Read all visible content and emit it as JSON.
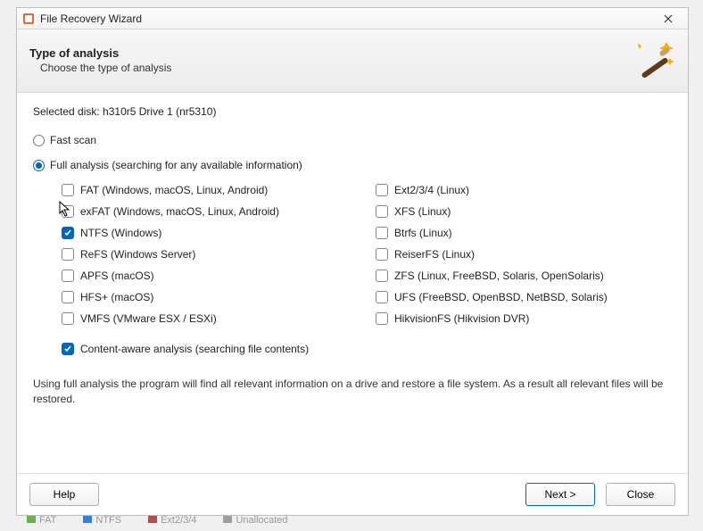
{
  "window": {
    "title": "File Recovery Wizard"
  },
  "header": {
    "title": "Type of analysis",
    "subtitle": "Choose the type of analysis"
  },
  "selected_disk_label": "Selected disk: h310r5 Drive 1 (nr5310)",
  "radios": {
    "fast_label": "Fast scan",
    "full_label": "Full analysis (searching for any available information)"
  },
  "filesystems_left": [
    {
      "label": "FAT (Windows, macOS, Linux, Android)",
      "checked": false
    },
    {
      "label": "exFAT (Windows, macOS, Linux, Android)",
      "checked": false
    },
    {
      "label": "NTFS (Windows)",
      "checked": true
    },
    {
      "label": "ReFS (Windows Server)",
      "checked": false
    },
    {
      "label": "APFS (macOS)",
      "checked": false
    },
    {
      "label": "HFS+ (macOS)",
      "checked": false
    },
    {
      "label": "VMFS (VMware ESX / ESXi)",
      "checked": false
    }
  ],
  "filesystems_right": [
    {
      "label": "Ext2/3/4 (Linux)",
      "checked": false
    },
    {
      "label": "XFS (Linux)",
      "checked": false
    },
    {
      "label": "Btrfs (Linux)",
      "checked": false
    },
    {
      "label": "ReiserFS (Linux)",
      "checked": false
    },
    {
      "label": "ZFS (Linux, FreeBSD, Solaris, OpenSolaris)",
      "checked": false
    },
    {
      "label": "UFS (FreeBSD, OpenBSD, NetBSD, Solaris)",
      "checked": false
    },
    {
      "label": "HikvisionFS (Hikvision DVR)",
      "checked": false
    }
  ],
  "content_aware": {
    "label": "Content-aware analysis (searching file contents)",
    "checked": true
  },
  "description": "Using full analysis the program will find all relevant information on a drive and restore a file system. As a result all relevant files will be restored.",
  "buttons": {
    "help": "Help",
    "next": "Next >",
    "close": "Close"
  },
  "bg_legend": [
    "FAT",
    "NTFS",
    "Ext2/3/4",
    "Unallocated"
  ]
}
